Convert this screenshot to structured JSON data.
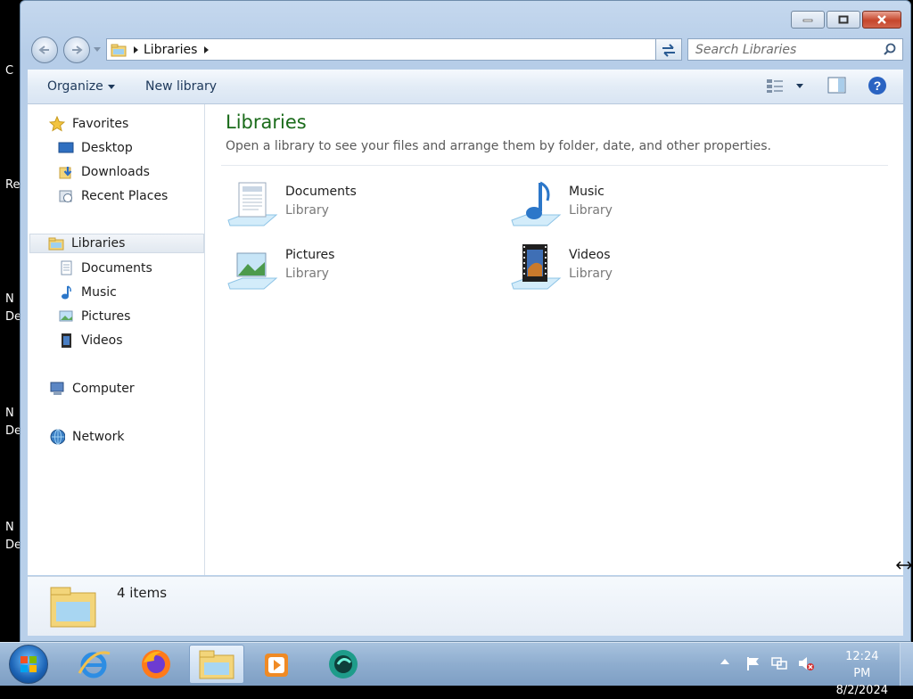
{
  "desktop_fragments": [
    "C",
    "Re",
    "N",
    "De",
    "N",
    "De",
    "N",
    "De"
  ],
  "window": {
    "address": {
      "crumb": "Libraries"
    },
    "search": {
      "placeholder": "Search Libraries"
    },
    "toolbar": {
      "organize": "Organize",
      "new_library": "New library"
    }
  },
  "nav_pane": {
    "favorites": {
      "label": "Favorites",
      "items": [
        "Desktop",
        "Downloads",
        "Recent Places"
      ]
    },
    "libraries": {
      "label": "Libraries",
      "items": [
        "Documents",
        "Music",
        "Pictures",
        "Videos"
      ]
    },
    "computer": "Computer",
    "network": "Network"
  },
  "content": {
    "title": "Libraries",
    "subtitle": "Open a library to see your files and arrange them by folder, date, and other properties.",
    "libraries": [
      {
        "name": "Documents",
        "type": "Library",
        "icon": "documents-library-icon"
      },
      {
        "name": "Music",
        "type": "Library",
        "icon": "music-library-icon"
      },
      {
        "name": "Pictures",
        "type": "Library",
        "icon": "pictures-library-icon"
      },
      {
        "name": "Videos",
        "type": "Library",
        "icon": "videos-library-icon"
      }
    ]
  },
  "details": {
    "count": "4 items"
  },
  "taskbar": {
    "apps": [
      "start-orb",
      "internet-explorer-icon",
      "firefox-icon",
      "windows-explorer-icon",
      "media-player-icon",
      "app-icon"
    ],
    "time": "12:24 PM",
    "date": "8/2/2024"
  },
  "colors": {
    "title_green": "#1a6b1a",
    "toolbar_text": "#1e395b",
    "close_red": "#c6462c"
  }
}
